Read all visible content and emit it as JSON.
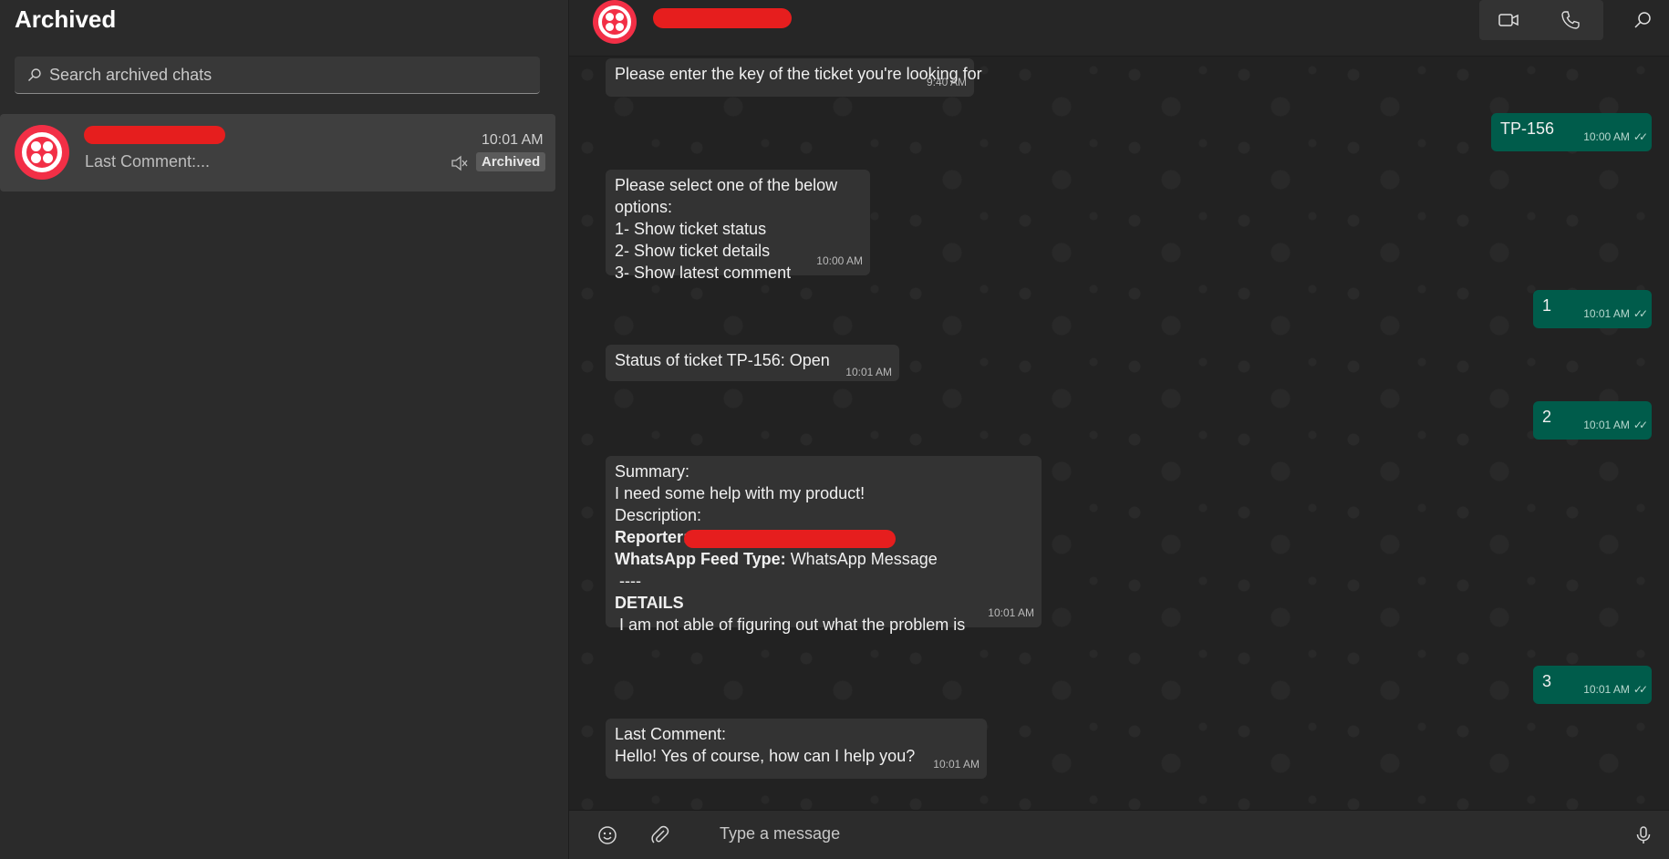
{
  "left": {
    "title": "Archived",
    "search_placeholder": "Search archived chats",
    "chat": {
      "time": "10:01 AM",
      "preview": "Last Comment:...",
      "badge": "Archived"
    }
  },
  "composer": {
    "placeholder": "Type a message"
  },
  "messages": [
    {
      "dir": "in",
      "text": "Please enter the key of the ticket you're looking for",
      "time": "9:40 AM"
    },
    {
      "dir": "out",
      "text": "TP-156",
      "time": "10:00 AM"
    },
    {
      "dir": "in",
      "lines": [
        "Please select one of the below options:",
        "1- Show ticket status",
        "2- Show ticket details",
        "3- Show latest comment"
      ],
      "time": "10:00 AM"
    },
    {
      "dir": "out",
      "text": "1",
      "time": "10:01 AM"
    },
    {
      "dir": "in",
      "text": "Status of ticket TP-156: Open",
      "time": "10:01 AM"
    },
    {
      "dir": "out",
      "text": "2",
      "time": "10:01 AM"
    },
    {
      "dir": "in",
      "details": {
        "summary_label": "Summary:",
        "summary": "I need some help with my product!",
        "description_label": "Description:",
        "reporter_label": "Reporter:",
        "feed_label": "WhatsApp Feed Type:",
        "feed_value": " WhatsApp Message",
        "separator": " ----",
        "details_label": "DETAILS",
        "details_text": " I am not able of figuring out what the problem is"
      },
      "time": "10:01 AM"
    },
    {
      "dir": "out",
      "text": "3",
      "time": "10:01 AM"
    },
    {
      "dir": "in",
      "lines": [
        "Last Comment:",
        "Hello! Yes of course, how can I help you?"
      ],
      "time": "10:01 AM"
    }
  ],
  "icons": {
    "search": "search-icon",
    "mute": "mute-icon",
    "video": "video-call-icon",
    "phone": "phone-call-icon",
    "header_search": "search-icon",
    "emoji": "emoji-icon",
    "attach": "paperclip-icon",
    "mic": "microphone-icon"
  },
  "colors": {
    "brand": "#f22f46",
    "outgoing": "#005c4b",
    "incoming": "#333333"
  }
}
